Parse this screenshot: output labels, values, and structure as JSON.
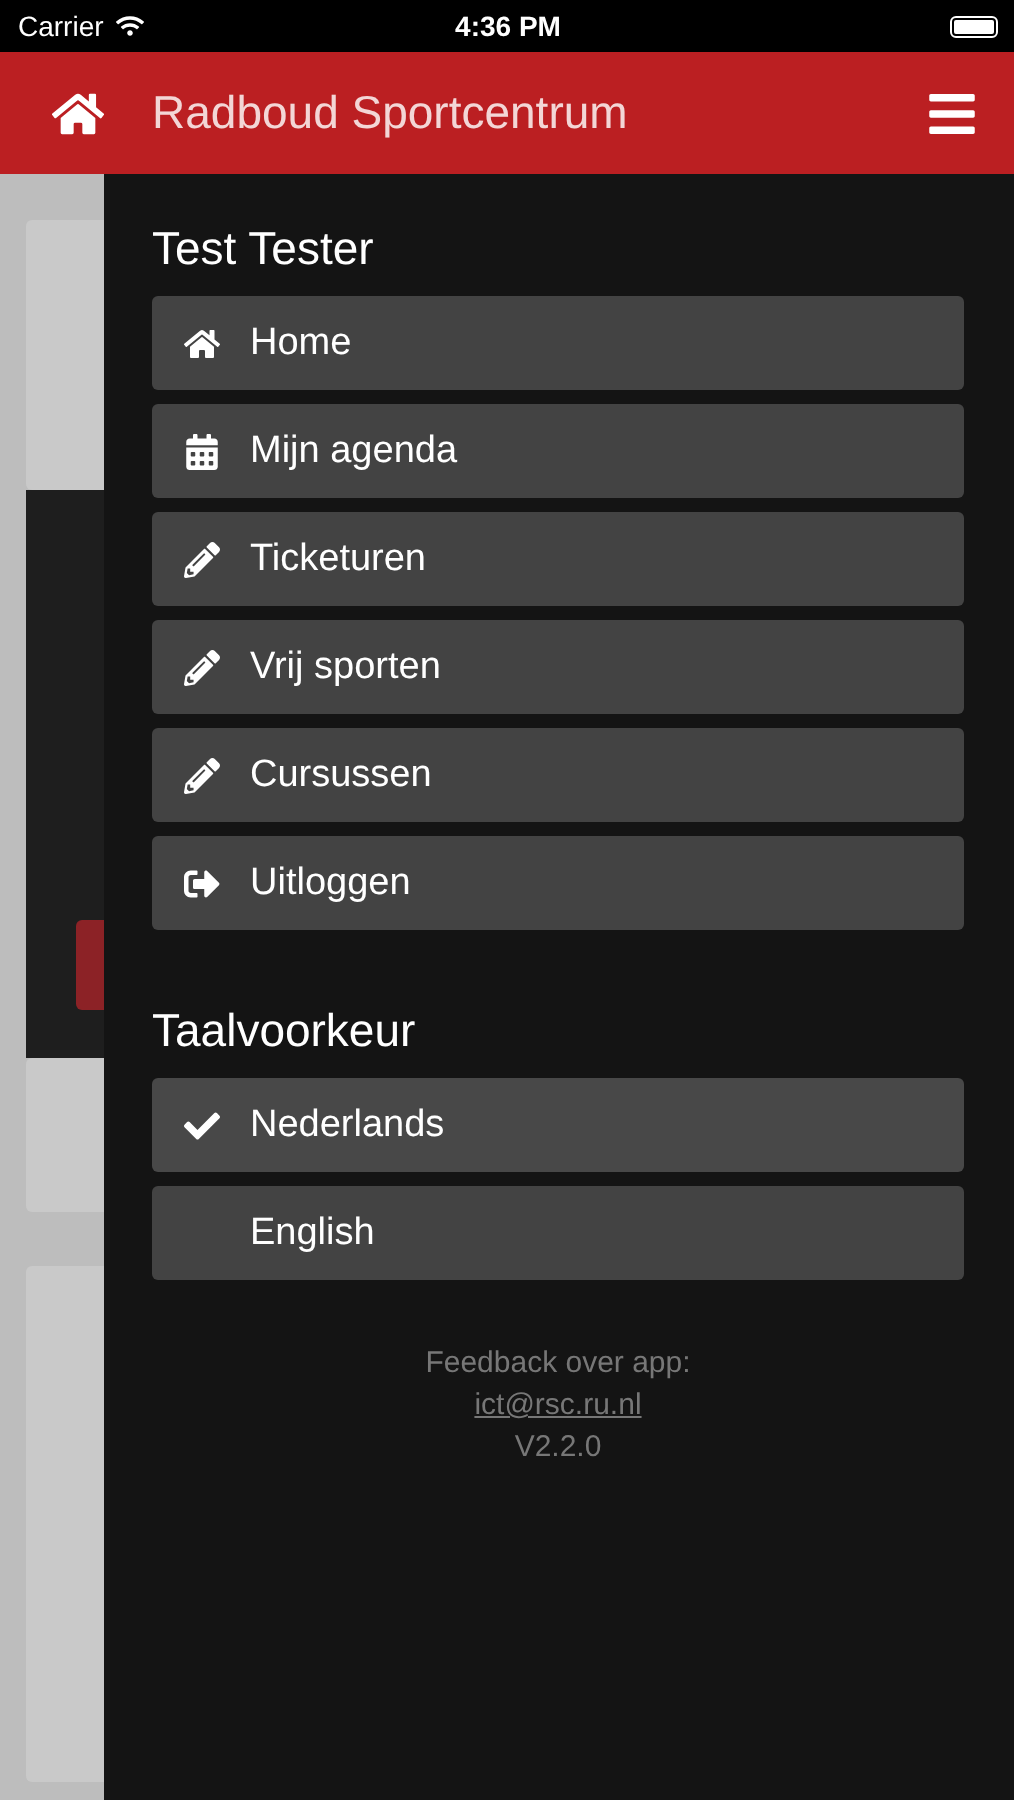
{
  "status_bar": {
    "carrier": "Carrier",
    "time": "4:36 PM"
  },
  "header": {
    "title": "Radboud Sportcentrum"
  },
  "drawer": {
    "user": "Test Tester",
    "menu": [
      {
        "label": "Home",
        "kind": "home"
      },
      {
        "label": "Mijn agenda",
        "kind": "calendar"
      },
      {
        "label": "Ticketuren",
        "kind": "pencil"
      },
      {
        "label": "Vrij sporten",
        "kind": "pencil"
      },
      {
        "label": "Cursussen",
        "kind": "pencil"
      },
      {
        "label": "Uitloggen",
        "kind": "logout"
      }
    ],
    "language_title": "Taalvoorkeur",
    "languages": [
      {
        "label": "Nederlands",
        "selected": true
      },
      {
        "label": "English",
        "selected": false
      }
    ],
    "feedback": {
      "label": "Feedback over app:",
      "email": "ict@rsc.ru.nl",
      "version": "V2.2.0"
    }
  }
}
